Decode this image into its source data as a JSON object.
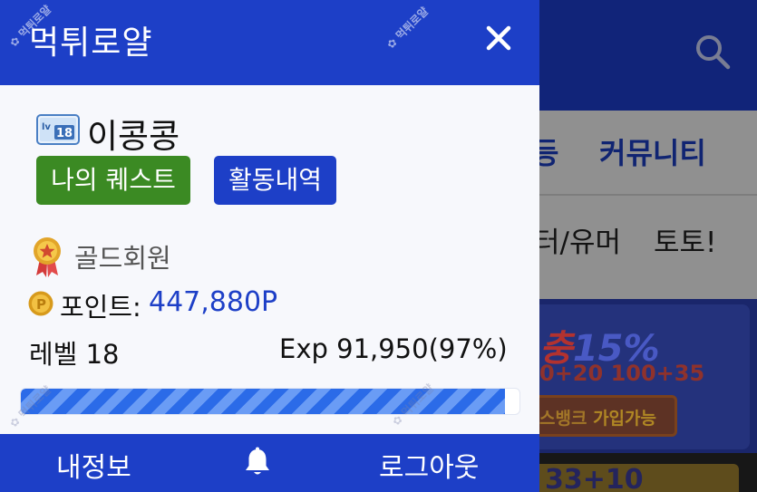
{
  "drawer": {
    "title": "먹튀로얄",
    "close_icon": "close-icon",
    "user": {
      "level_badge_icon": "level-badge-icon",
      "username": "이콩콩"
    },
    "buttons": {
      "quest": "나의 퀘스트",
      "activity": "활동내역"
    },
    "grade": {
      "icon": "gold-medal-icon",
      "label": "골드회원"
    },
    "points": {
      "icon": "coin-icon",
      "label": "포인트:",
      "value": "447,880P"
    },
    "level_text": "레벨 18",
    "exp_text": "Exp 91,950(97%)",
    "exp_progress_percent": 97,
    "footer": {
      "my_info": "내정보",
      "bell_icon": "bell-icon",
      "logout": "로그아웃"
    },
    "colors": {
      "primary": "#1d3fc7",
      "quest_green": "#3b8a23",
      "points_blue": "#1d3fc7"
    }
  },
  "background_page": {
    "search_icon": "search-icon",
    "nav_row1": [
      "등",
      "커뮤니티"
    ],
    "nav_row2": [
      "터/유머",
      "토토!"
    ],
    "banner": {
      "headline_left": "충",
      "headline_pct": "15%",
      "bonus": "0+20 100+35",
      "cta_left": "스뱅크 ",
      "cta_right": "가입가능"
    },
    "banner2_text": "33+10"
  }
}
